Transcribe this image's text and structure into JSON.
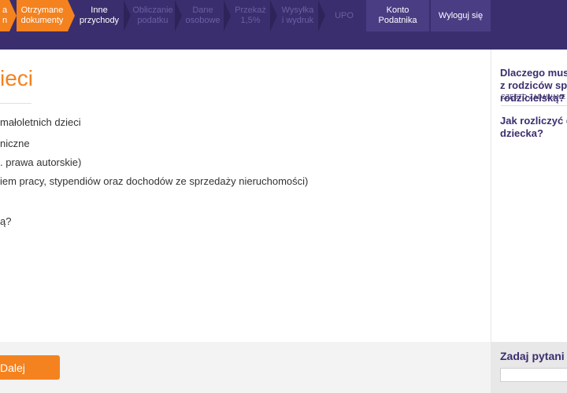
{
  "nav": {
    "steps": [
      {
        "label": "a\nn",
        "state": "done"
      },
      {
        "label": "Otrzymane\ndokumenty",
        "state": "done"
      },
      {
        "label": "Inne\nprzychody",
        "state": "active"
      },
      {
        "label": "Obliczanie\npodatku",
        "state": "inactive"
      },
      {
        "label": "Dane\nosobowe",
        "state": "inactive"
      },
      {
        "label": "Przekaż\n1,5%",
        "state": "inactive"
      },
      {
        "label": "Wysyłka\ni wydruk",
        "state": "inactive"
      },
      {
        "label": "UPO",
        "state": "inactive"
      }
    ],
    "account_label": "Konto\nPodatnika",
    "logout_label": "Wyloguj się"
  },
  "main": {
    "title": "ieci",
    "lines": [
      "małoletnich dzieci",
      "niczne",
      ". prawa autorskie)",
      "iem pracy, stypendiów oraz dochodów ze sprzedaży nieruchomości)",
      "ą?"
    ],
    "next_label": "Dalej"
  },
  "sidebar": {
    "faq_heading": "CZĘSTO ZADAWANE P",
    "questions": [
      "Dlaczego mus\nz rodziców spr\nrodzicielską?",
      "Jak rozliczyć d\ndziecka?"
    ],
    "ask_label": "Zadaj pytani"
  }
}
